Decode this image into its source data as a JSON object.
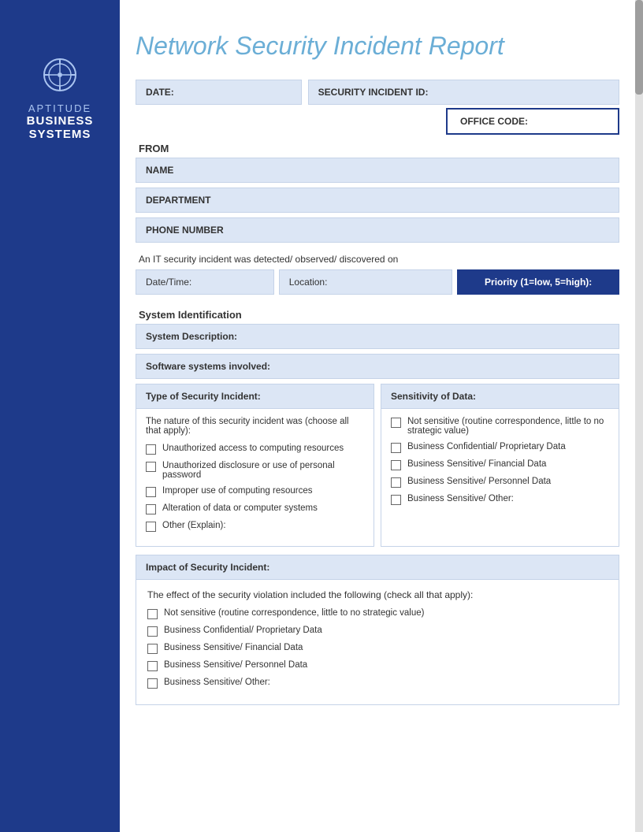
{
  "sidebar": {
    "aptitude_label": "APTITUDE",
    "business_label": "BUSINESS",
    "systems_label": "SYSTEMS"
  },
  "header": {
    "title": "Network Security Incident Report"
  },
  "form": {
    "date_label": "DATE:",
    "security_incident_id_label": "SECURITY INCIDENT ID:",
    "office_code_label": "OFFICE CODE:",
    "from_label": "FROM",
    "name_label": "NAME",
    "department_label": "DEPARTMENT",
    "phone_label": "PHONE NUMBER",
    "it_incident_text": "An IT security incident was detected/ observed/ discovered on",
    "datetime_label": "Date/Time:",
    "location_label": "Location:",
    "priority_label": "Priority (1=low, 5=high):",
    "system_identification_label": "System Identification",
    "system_description_label": "System Description:",
    "software_systems_label": "Software systems involved:"
  },
  "security_type": {
    "header": "Type of Security Incident:",
    "subheading": "The nature of this security incident was (choose all that apply):",
    "items": [
      "Unauthorized access to computing resources",
      "Unauthorized disclosure or use of personal password",
      "Improper use of computing resources",
      "Alteration of data or computer systems",
      "Other (Explain):"
    ]
  },
  "sensitivity": {
    "header": "Sensitivity of Data:",
    "items": [
      "Not sensitive (routine correspondence, little to no strategic value)",
      "Business Confidential/ Proprietary Data",
      "Business Sensitive/ Financial Data",
      "Business Sensitive/ Personnel Data",
      "Business Sensitive/ Other:"
    ]
  },
  "impact": {
    "header": "Impact of Security Incident:",
    "subheading": "The effect of the security violation included the following (check all that apply):",
    "items": [
      "Not sensitive (routine correspondence, little to no strategic value)",
      "Business Confidential/ Proprietary Data",
      "Business Sensitive/ Financial Data",
      "Business Sensitive/ Personnel Data",
      "Business Sensitive/ Other:"
    ]
  }
}
